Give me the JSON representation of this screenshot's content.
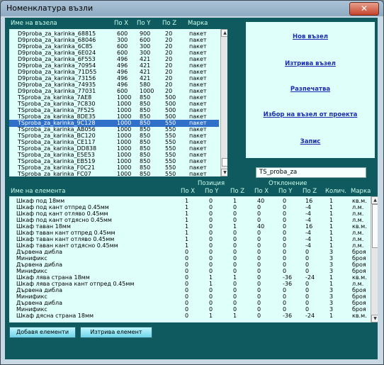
{
  "window": {
    "title": "Номенклатура възли",
    "close": "✕"
  },
  "nodes": {
    "headers": {
      "name": "Име на възела",
      "x": "По X",
      "y": "По Y",
      "z": "По Z",
      "brand": "Марка"
    },
    "rows": [
      [
        "D9proba_za_karinka_68815",
        "600",
        "900",
        "20",
        "пакет"
      ],
      [
        "D9proba_za_karinka_68046",
        "300",
        "600",
        "20",
        "пакет"
      ],
      [
        "D9proba_za_karinka_6C85",
        "600",
        "300",
        "20",
        "пакет"
      ],
      [
        "D9proba_za_karinka_6E024",
        "600",
        "300",
        "20",
        "пакет"
      ],
      [
        "D9proba_za_karinka_6F553",
        "496",
        "421",
        "20",
        "пакет"
      ],
      [
        "D9proba_za_karinka_70954",
        "496",
        "421",
        "20",
        "пакет"
      ],
      [
        "D9proba_za_karinka_71D55",
        "496",
        "421",
        "20",
        "пакет"
      ],
      [
        "D9proba_za_karinka_73156",
        "496",
        "421",
        "20",
        "пакет"
      ],
      [
        "D9proba_za_karinka_74935",
        "496",
        "580",
        "20",
        "пакет"
      ],
      [
        "D9proba_za_karinka_77031",
        "600",
        "1000",
        "20",
        "пакет"
      ],
      [
        "TSproba_za_karinka_7AE8",
        "1000",
        "850",
        "500",
        "пакет"
      ],
      [
        "TSproba_za_karinka_7C830",
        "1000",
        "850",
        "500",
        "пакет"
      ],
      [
        "TSproba_za_karinka_7F525",
        "1000",
        "850",
        "500",
        "пакет"
      ],
      [
        "TSproba_za_karinka_8DE35",
        "1000",
        "850",
        "500",
        "пакет"
      ],
      [
        "TSproba_za_karinka_9C128",
        "1000",
        "850",
        "550",
        "пакет"
      ],
      [
        "TSproba_za_karinka_AB056",
        "1000",
        "850",
        "550",
        "пакет"
      ],
      [
        "TSproba_za_karinka_BC120",
        "1000",
        "850",
        "550",
        "пакет"
      ],
      [
        "TSproba_za_karinka_CE117",
        "1000",
        "850",
        "550",
        "пакет"
      ],
      [
        "TSproba_za_karinka_DD838",
        "1000",
        "850",
        "550",
        "пакет"
      ],
      [
        "TSproba_za_karinka_E5E53",
        "1000",
        "850",
        "550",
        "пакет"
      ],
      [
        "TSproba_za_karinka_EB519",
        "1000",
        "850",
        "550",
        "пакет"
      ],
      [
        "TSproba_za_karinka_F0C21",
        "1000",
        "850",
        "550",
        "пакет"
      ],
      [
        "TSproba_za_karinka_FC07",
        "1000",
        "850",
        "550",
        "пакет"
      ]
    ],
    "selected_index": 14
  },
  "actions": {
    "new_node": "Нов възел",
    "delete_node": "Изтрива възел",
    "print": "Разпечатва",
    "select_from_project": "Избор на възел от проекта",
    "save": "Запис"
  },
  "node_name_field": {
    "value": "TS_proba_za"
  },
  "elements": {
    "group_position": "Позиция",
    "group_deviation": "Отклонение",
    "headers": {
      "name": "Име на елемента",
      "px": "По X",
      "py": "По Y",
      "pz": "По Z",
      "dx": "По X",
      "dy": "По Y",
      "dz": "По Z",
      "qty": "Колич.",
      "brand": "Марка"
    },
    "rows": [
      [
        "Шкаф под 18мм",
        "1",
        "0",
        "1",
        "40",
        "0",
        "16",
        "1",
        "кв.м."
      ],
      [
        "Шкаф под кант отпред 0.45мм",
        "1",
        "0",
        "0",
        "0",
        "0",
        "-4",
        "1",
        "л.м."
      ],
      [
        "Шкаф под кант отляво 0.45мм",
        "1",
        "0",
        "0",
        "0",
        "0",
        "-4",
        "1",
        "л.м."
      ],
      [
        "Шкаф под кант отдясно 0.45мм",
        "1",
        "0",
        "0",
        "0",
        "0",
        "-4",
        "1",
        "л.м."
      ],
      [
        "Шкаф таван 18мм",
        "1",
        "0",
        "1",
        "40",
        "0",
        "16",
        "1",
        "кв.м."
      ],
      [
        "Шкаф таван кант отпред 0.45мм",
        "1",
        "0",
        "0",
        "0",
        "0",
        "-4",
        "1",
        "л.м."
      ],
      [
        "Шкаф таван кант отляво 0.45мм",
        "1",
        "0",
        "0",
        "0",
        "0",
        "-4",
        "1",
        "л.м."
      ],
      [
        "Шкаф таван кант отдясно 0.45мм",
        "1",
        "0",
        "0",
        "0",
        "0",
        "-4",
        "1",
        "л.м."
      ],
      [
        "Дървена дибла",
        "0",
        "0",
        "0",
        "0",
        "0",
        "0",
        "3",
        "броя"
      ],
      [
        "Минификс",
        "0",
        "0",
        "0",
        "0",
        "0",
        "0",
        "3",
        "броя"
      ],
      [
        "Дървена дибла",
        "0",
        "0",
        "0",
        "0",
        "0",
        "0",
        "3",
        "броя"
      ],
      [
        "Минификс",
        "0",
        "0",
        "0",
        "0",
        "0",
        "0",
        "3",
        "броя"
      ],
      [
        "Шкаф лява страна 18мм",
        "0",
        "1",
        "1",
        "0",
        "-36",
        "-24",
        "1",
        "кв.м."
      ],
      [
        "Шкаф лява страна кант отпред 0.45мм",
        "0",
        "1",
        "0",
        "0",
        "-36",
        "0",
        "1",
        "л.м."
      ],
      [
        "Дървена дибла",
        "0",
        "0",
        "0",
        "0",
        "0",
        "0",
        "3",
        "броя"
      ],
      [
        "Минификс",
        "0",
        "0",
        "0",
        "0",
        "0",
        "0",
        "3",
        "броя"
      ],
      [
        "Дървена дибла",
        "0",
        "0",
        "0",
        "0",
        "0",
        "0",
        "3",
        "броя"
      ],
      [
        "Минификс",
        "0",
        "0",
        "0",
        "0",
        "0",
        "0",
        "3",
        "броя"
      ],
      [
        "Шкаф дясна страна 18мм",
        "0",
        "1",
        "1",
        "0",
        "-36",
        "-24",
        "1",
        "кв.м."
      ]
    ]
  },
  "buttons": {
    "add_elements": "Добавя елементи",
    "delete_element": "Изтрива елемент"
  },
  "colors": {
    "background": "#0e5a5e",
    "list_bg": "#dffffb",
    "selection": "#3070c8",
    "link": "#1a2cb0"
  }
}
